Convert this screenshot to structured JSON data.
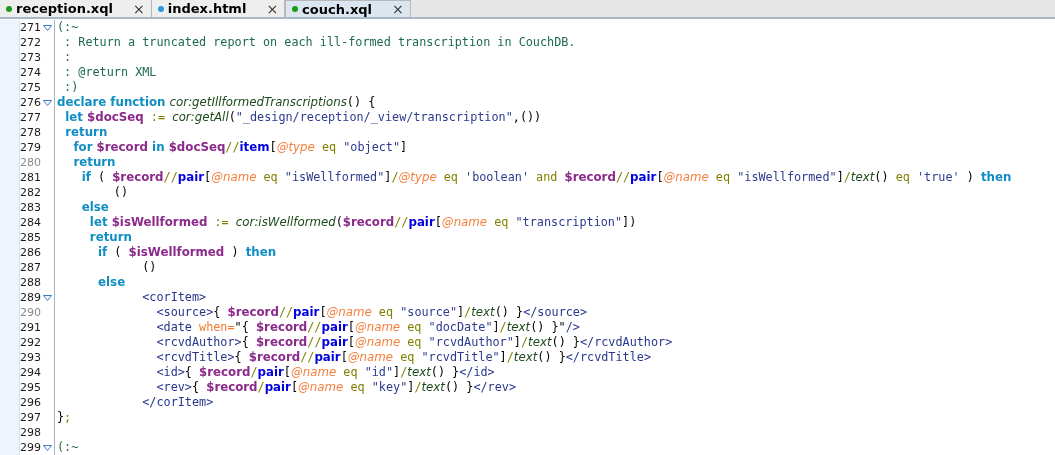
{
  "tabs": [
    {
      "label": "reception.xql",
      "close": "×",
      "color": "#1a9a1a",
      "selected": false
    },
    {
      "label": "index.html",
      "close": "×",
      "color": "#2a9ad8",
      "selected": false
    },
    {
      "label": "couch.xql",
      "close": "×",
      "color": "#1a9a1a",
      "selected": true
    }
  ],
  "editor": {
    "lines": [
      {
        "number": "271",
        "fold": true,
        "dim": false,
        "tokens": [
          {
            "kind": "comment",
            "text": "(:~"
          }
        ]
      },
      {
        "number": "272",
        "fold": false,
        "dim": false,
        "tokens": [
          {
            "kind": "comment",
            "text": " : Return a truncated report on each ill-formed transcription in CouchDB."
          }
        ]
      },
      {
        "number": "273",
        "fold": false,
        "dim": false,
        "tokens": [
          {
            "kind": "comment",
            "text": " :"
          }
        ]
      },
      {
        "number": "274",
        "fold": false,
        "dim": false,
        "tokens": [
          {
            "kind": "comment",
            "text": " : @return XML"
          }
        ]
      },
      {
        "number": "275",
        "fold": false,
        "dim": false,
        "tokens": [
          {
            "kind": "comment",
            "text": " :)"
          }
        ]
      },
      {
        "number": "276",
        "fold": true,
        "dim": false,
        "tokens": [
          {
            "kind": "kw",
            "text": "declare function "
          },
          {
            "kind": "fn",
            "text": "cor:getIllformedTranscriptions"
          },
          {
            "kind": "plain",
            "text": "() {"
          }
        ]
      },
      {
        "number": "277",
        "fold": false,
        "dim": false,
        "tokens": [
          {
            "kind": "kw",
            "text": "  let "
          },
          {
            "kind": "var",
            "text": "$docSeq"
          },
          {
            "kind": "op",
            "text": " := "
          },
          {
            "kind": "fn",
            "text": "cor:getAll"
          },
          {
            "kind": "plain",
            "text": "("
          },
          {
            "kind": "str",
            "text": "\"_design/reception/_view/transcription\""
          },
          {
            "kind": "plain",
            "text": ",())"
          }
        ]
      },
      {
        "number": "278",
        "fold": false,
        "dim": false,
        "tokens": [
          {
            "kind": "kw",
            "text": "  return"
          }
        ]
      },
      {
        "number": "279",
        "fold": false,
        "dim": false,
        "tokens": [
          {
            "kind": "kw",
            "text": "    for "
          },
          {
            "kind": "var",
            "text": "$record "
          },
          {
            "kind": "kw",
            "text": "in "
          },
          {
            "kind": "var",
            "text": "$docSeq"
          },
          {
            "kind": "op",
            "text": "//"
          },
          {
            "kind": "axis",
            "text": "item"
          },
          {
            "kind": "plain",
            "text": "["
          },
          {
            "kind": "attr",
            "text": "@type"
          },
          {
            "kind": "op",
            "text": " eq "
          },
          {
            "kind": "str",
            "text": "\"object\""
          },
          {
            "kind": "plain",
            "text": "]"
          }
        ]
      },
      {
        "number": "280",
        "fold": false,
        "dim": true,
        "tokens": [
          {
            "kind": "kw",
            "text": "    return"
          }
        ]
      },
      {
        "number": "281",
        "fold": false,
        "dim": false,
        "tokens": [
          {
            "kind": "kw",
            "text": "      if"
          },
          {
            "kind": "plain",
            "text": " ( "
          },
          {
            "kind": "var",
            "text": "$record"
          },
          {
            "kind": "op",
            "text": "//"
          },
          {
            "kind": "axis",
            "text": "pair"
          },
          {
            "kind": "plain",
            "text": "["
          },
          {
            "kind": "attr",
            "text": "@name"
          },
          {
            "kind": "op",
            "text": " eq "
          },
          {
            "kind": "str",
            "text": "\"isWellformed\""
          },
          {
            "kind": "plain",
            "text": "]"
          },
          {
            "kind": "op",
            "text": "/"
          },
          {
            "kind": "attr",
            "text": "@type"
          },
          {
            "kind": "op",
            "text": " eq "
          },
          {
            "kind": "str",
            "text": "'boolean'"
          },
          {
            "kind": "op",
            "text": " and "
          },
          {
            "kind": "var",
            "text": "$record"
          },
          {
            "kind": "op",
            "text": "//"
          },
          {
            "kind": "axis",
            "text": "pair"
          },
          {
            "kind": "plain",
            "text": "["
          },
          {
            "kind": "attr",
            "text": "@name"
          },
          {
            "kind": "op",
            "text": " eq "
          },
          {
            "kind": "str",
            "text": "\"isWellformed\""
          },
          {
            "kind": "plain",
            "text": "]"
          },
          {
            "kind": "op",
            "text": "/"
          },
          {
            "kind": "fn",
            "text": "text"
          },
          {
            "kind": "plain",
            "text": "()"
          },
          {
            "kind": "op",
            "text": " eq "
          },
          {
            "kind": "str",
            "text": "'true'"
          },
          {
            "kind": "plain",
            "text": " ) "
          },
          {
            "kind": "kw",
            "text": "then"
          }
        ]
      },
      {
        "number": "282",
        "fold": false,
        "dim": false,
        "tokens": [
          {
            "kind": "plain",
            "text": "        ()"
          }
        ]
      },
      {
        "number": "283",
        "fold": false,
        "dim": false,
        "tokens": [
          {
            "kind": "kw",
            "text": "      else"
          }
        ]
      },
      {
        "number": "284",
        "fold": false,
        "dim": false,
        "tokens": [
          {
            "kind": "kw",
            "text": "        let "
          },
          {
            "kind": "var",
            "text": "$isWellformed"
          },
          {
            "kind": "op",
            "text": " := "
          },
          {
            "kind": "fn",
            "text": "cor:isWellformed"
          },
          {
            "kind": "plain",
            "text": "("
          },
          {
            "kind": "var",
            "text": "$record"
          },
          {
            "kind": "op",
            "text": "//"
          },
          {
            "kind": "axis",
            "text": "pair"
          },
          {
            "kind": "plain",
            "text": "["
          },
          {
            "kind": "attr",
            "text": "@name"
          },
          {
            "kind": "op",
            "text": " eq "
          },
          {
            "kind": "str",
            "text": "\"transcription\""
          },
          {
            "kind": "plain",
            "text": "])"
          }
        ]
      },
      {
        "number": "285",
        "fold": false,
        "dim": false,
        "tokens": [
          {
            "kind": "kw",
            "text": "        return"
          }
        ]
      },
      {
        "number": "286",
        "fold": false,
        "dim": false,
        "tokens": [
          {
            "kind": "kw",
            "text": "          if"
          },
          {
            "kind": "plain",
            "text": " ( "
          },
          {
            "kind": "var",
            "text": "$isWellformed"
          },
          {
            "kind": "plain",
            "text": " ) "
          },
          {
            "kind": "kw",
            "text": "then"
          }
        ]
      },
      {
        "number": "287",
        "fold": false,
        "dim": false,
        "tokens": [
          {
            "kind": "plain",
            "text": "            ()"
          }
        ]
      },
      {
        "number": "288",
        "fold": false,
        "dim": false,
        "tokens": [
          {
            "kind": "kw",
            "text": "          else"
          }
        ]
      },
      {
        "number": "289",
        "fold": true,
        "dim": false,
        "tokens": [
          {
            "kind": "tag",
            "text": "            <corItem>"
          }
        ]
      },
      {
        "number": "290",
        "fold": false,
        "dim": true,
        "tokens": [
          {
            "kind": "tag",
            "text": "              <source>"
          },
          {
            "kind": "plain",
            "text": "{ "
          },
          {
            "kind": "var",
            "text": "$record"
          },
          {
            "kind": "op",
            "text": "//"
          },
          {
            "kind": "axis",
            "text": "pair"
          },
          {
            "kind": "plain",
            "text": "["
          },
          {
            "kind": "attr",
            "text": "@name"
          },
          {
            "kind": "op",
            "text": " eq "
          },
          {
            "kind": "str",
            "text": "\"source\""
          },
          {
            "kind": "plain",
            "text": "]"
          },
          {
            "kind": "op",
            "text": "/"
          },
          {
            "kind": "fn",
            "text": "text"
          },
          {
            "kind": "plain",
            "text": "() }"
          },
          {
            "kind": "tag",
            "text": "</source>"
          }
        ]
      },
      {
        "number": "291",
        "fold": false,
        "dim": false,
        "tokens": [
          {
            "kind": "tag",
            "text": "              <date "
          },
          {
            "kind": "xattr",
            "text": "when="
          },
          {
            "kind": "plain",
            "text": "\"{ "
          },
          {
            "kind": "var",
            "text": "$record"
          },
          {
            "kind": "op",
            "text": "//"
          },
          {
            "kind": "axis",
            "text": "pair"
          },
          {
            "kind": "plain",
            "text": "["
          },
          {
            "kind": "attr",
            "text": "@name"
          },
          {
            "kind": "op",
            "text": " eq "
          },
          {
            "kind": "str",
            "text": "\"docDate\""
          },
          {
            "kind": "plain",
            "text": "]"
          },
          {
            "kind": "op",
            "text": "/"
          },
          {
            "kind": "fn",
            "text": "text"
          },
          {
            "kind": "plain",
            "text": "() }\""
          },
          {
            "kind": "tag",
            "text": "/>"
          }
        ]
      },
      {
        "number": "292",
        "fold": false,
        "dim": false,
        "tokens": [
          {
            "kind": "tag",
            "text": "              <rcvdAuthor>"
          },
          {
            "kind": "plain",
            "text": "{ "
          },
          {
            "kind": "var",
            "text": "$record"
          },
          {
            "kind": "op",
            "text": "//"
          },
          {
            "kind": "axis",
            "text": "pair"
          },
          {
            "kind": "plain",
            "text": "["
          },
          {
            "kind": "attr",
            "text": "@name"
          },
          {
            "kind": "op",
            "text": " eq "
          },
          {
            "kind": "str",
            "text": "\"rcvdAuthor\""
          },
          {
            "kind": "plain",
            "text": "]"
          },
          {
            "kind": "op",
            "text": "/"
          },
          {
            "kind": "fn",
            "text": "text"
          },
          {
            "kind": "plain",
            "text": "() }"
          },
          {
            "kind": "tag",
            "text": "</rcvdAuthor>"
          }
        ]
      },
      {
        "number": "293",
        "fold": false,
        "dim": false,
        "tokens": [
          {
            "kind": "tag",
            "text": "              <rcvdTitle>"
          },
          {
            "kind": "plain",
            "text": "{ "
          },
          {
            "kind": "var",
            "text": "$record"
          },
          {
            "kind": "op",
            "text": "//"
          },
          {
            "kind": "axis",
            "text": "pair"
          },
          {
            "kind": "plain",
            "text": "["
          },
          {
            "kind": "attr",
            "text": "@name"
          },
          {
            "kind": "op",
            "text": " eq "
          },
          {
            "kind": "str",
            "text": "\"rcvdTitle\""
          },
          {
            "kind": "plain",
            "text": "]"
          },
          {
            "kind": "op",
            "text": "/"
          },
          {
            "kind": "fn",
            "text": "text"
          },
          {
            "kind": "plain",
            "text": "() }"
          },
          {
            "kind": "tag",
            "text": "</rcvdTitle>"
          }
        ]
      },
      {
        "number": "294",
        "fold": false,
        "dim": false,
        "tokens": [
          {
            "kind": "tag",
            "text": "              <id>"
          },
          {
            "kind": "plain",
            "text": "{ "
          },
          {
            "kind": "var",
            "text": "$record"
          },
          {
            "kind": "op",
            "text": "/"
          },
          {
            "kind": "axis",
            "text": "pair"
          },
          {
            "kind": "plain",
            "text": "["
          },
          {
            "kind": "attr",
            "text": "@name"
          },
          {
            "kind": "op",
            "text": " eq "
          },
          {
            "kind": "str",
            "text": "\"id\""
          },
          {
            "kind": "plain",
            "text": "]"
          },
          {
            "kind": "op",
            "text": "/"
          },
          {
            "kind": "fn",
            "text": "text"
          },
          {
            "kind": "plain",
            "text": "() }"
          },
          {
            "kind": "tag",
            "text": "</id>"
          }
        ]
      },
      {
        "number": "295",
        "fold": false,
        "dim": false,
        "tokens": [
          {
            "kind": "tag",
            "text": "              <rev>"
          },
          {
            "kind": "plain",
            "text": "{ "
          },
          {
            "kind": "var",
            "text": "$record"
          },
          {
            "kind": "op",
            "text": "/"
          },
          {
            "kind": "axis",
            "text": "pair"
          },
          {
            "kind": "plain",
            "text": "["
          },
          {
            "kind": "attr",
            "text": "@name"
          },
          {
            "kind": "op",
            "text": " eq "
          },
          {
            "kind": "str",
            "text": "\"key\""
          },
          {
            "kind": "plain",
            "text": "]"
          },
          {
            "kind": "op",
            "text": "/"
          },
          {
            "kind": "fn",
            "text": "text"
          },
          {
            "kind": "plain",
            "text": "() }"
          },
          {
            "kind": "tag",
            "text": "</rev>"
          }
        ]
      },
      {
        "number": "296",
        "fold": false,
        "dim": false,
        "tokens": [
          {
            "kind": "tag",
            "text": "            </corItem>"
          }
        ]
      },
      {
        "number": "297",
        "fold": false,
        "dim": false,
        "tokens": [
          {
            "kind": "plain",
            "text": "}"
          },
          {
            "kind": "op",
            "text": ";"
          }
        ]
      },
      {
        "number": "298",
        "fold": false,
        "dim": false
      },
      {
        "number": "299",
        "fold": true,
        "dim": false,
        "tokens": [
          {
            "kind": "comment",
            "text": "(:~"
          }
        ]
      }
    ]
  }
}
